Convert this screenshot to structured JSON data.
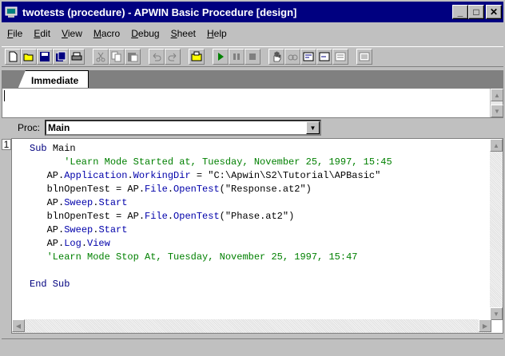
{
  "window": {
    "title": "twotests (procedure) - APWIN Basic Procedure [design]",
    "controls": {
      "minimize": "_",
      "maximize": "□",
      "close": "✕"
    }
  },
  "menu": [
    {
      "accel": "F",
      "rest": "ile"
    },
    {
      "accel": "E",
      "rest": "dit"
    },
    {
      "accel": "V",
      "rest": "iew"
    },
    {
      "accel": "M",
      "rest": "acro"
    },
    {
      "accel": "D",
      "rest": "ebug"
    },
    {
      "accel": "S",
      "rest": "heet"
    },
    {
      "accel": "H",
      "rest": "elp"
    }
  ],
  "toolbar": {
    "icons": [
      "new-file-icon",
      "open-folder-icon",
      "save-icon",
      "save-all-icon",
      "print-icon",
      "cut-icon",
      "copy-icon",
      "paste-icon",
      "undo-icon",
      "redo-icon",
      "references-icon",
      "run-icon",
      "pause-icon",
      "stop-icon",
      "hand-icon",
      "watch-icon",
      "step-into-icon",
      "step-over-icon",
      "step-out-icon",
      "toggle-breakpoint-icon"
    ]
  },
  "immediate": {
    "tab_label": "Immediate",
    "value": ""
  },
  "proc": {
    "label": "Proc:",
    "selected": "Main"
  },
  "code": {
    "line_number": "1",
    "lines": [
      {
        "parts": [
          {
            "t": "Sub ",
            "c": "kw"
          },
          {
            "t": "Main",
            "c": ""
          }
        ]
      },
      {
        "parts": [
          {
            "t": "      'Learn Mode Started at, Tuesday, November 25, 1997, 15:45",
            "c": "cm"
          }
        ]
      },
      {
        "parts": [
          {
            "t": "   AP.",
            "c": ""
          },
          {
            "t": "Application",
            "c": "mth"
          },
          {
            "t": ".",
            "c": ""
          },
          {
            "t": "WorkingDir",
            "c": "mth"
          },
          {
            "t": " = \"C:\\Apwin\\S2\\Tutorial\\APBasic\"",
            "c": ""
          }
        ]
      },
      {
        "parts": [
          {
            "t": "   blnOpenTest = AP.",
            "c": ""
          },
          {
            "t": "File",
            "c": "mth"
          },
          {
            "t": ".",
            "c": ""
          },
          {
            "t": "OpenTest",
            "c": "mth"
          },
          {
            "t": "(\"Response.at2\")",
            "c": ""
          }
        ]
      },
      {
        "parts": [
          {
            "t": "   AP.",
            "c": ""
          },
          {
            "t": "Sweep",
            "c": "mth"
          },
          {
            "t": ".",
            "c": ""
          },
          {
            "t": "Start",
            "c": "mth"
          }
        ]
      },
      {
        "parts": [
          {
            "t": "   blnOpenTest = AP.",
            "c": ""
          },
          {
            "t": "File",
            "c": "mth"
          },
          {
            "t": ".",
            "c": ""
          },
          {
            "t": "OpenTest",
            "c": "mth"
          },
          {
            "t": "(\"Phase.at2\")",
            "c": ""
          }
        ]
      },
      {
        "parts": [
          {
            "t": "   AP.",
            "c": ""
          },
          {
            "t": "Sweep",
            "c": "mth"
          },
          {
            "t": ".",
            "c": ""
          },
          {
            "t": "Start",
            "c": "mth"
          }
        ]
      },
      {
        "parts": [
          {
            "t": "   AP.",
            "c": ""
          },
          {
            "t": "Log",
            "c": "mth"
          },
          {
            "t": ".",
            "c": ""
          },
          {
            "t": "View",
            "c": "mth"
          }
        ]
      },
      {
        "parts": [
          {
            "t": "   'Learn Mode Stop At, Tuesday, November 25, 1997, 15:47",
            "c": "cm"
          }
        ]
      },
      {
        "parts": [
          {
            "t": "",
            "c": ""
          }
        ]
      },
      {
        "parts": [
          {
            "t": "End Sub",
            "c": "kw"
          }
        ]
      }
    ]
  },
  "colors": {
    "title_bg": "#000080",
    "keyword": "#00007f",
    "comment": "#008000"
  }
}
